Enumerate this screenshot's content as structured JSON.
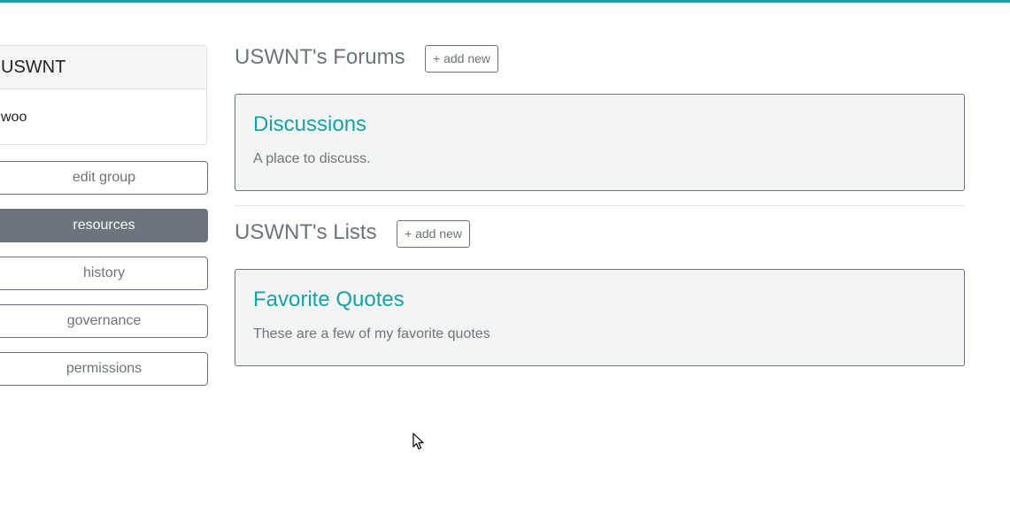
{
  "sidebar": {
    "group_name": "USWNT",
    "group_description": "woo",
    "buttons": [
      {
        "label": "edit group",
        "active": false
      },
      {
        "label": "resources",
        "active": true
      },
      {
        "label": "history",
        "active": false
      },
      {
        "label": "governance",
        "active": false
      },
      {
        "label": "permissions",
        "active": false
      }
    ]
  },
  "main": {
    "forums": {
      "title": "USWNT's Forums",
      "add_label": "+ add new",
      "items": [
        {
          "title": "Discussions",
          "description": "A place to discuss."
        }
      ]
    },
    "lists": {
      "title": "USWNT's Lists",
      "add_label": "+ add new",
      "items": [
        {
          "title": "Favorite Quotes",
          "description": "These are a few of my favorite quotes"
        }
      ]
    }
  },
  "colors": {
    "accent": "#17a2a8",
    "muted": "#6c757d",
    "card_bg": "#f3f5f5"
  }
}
